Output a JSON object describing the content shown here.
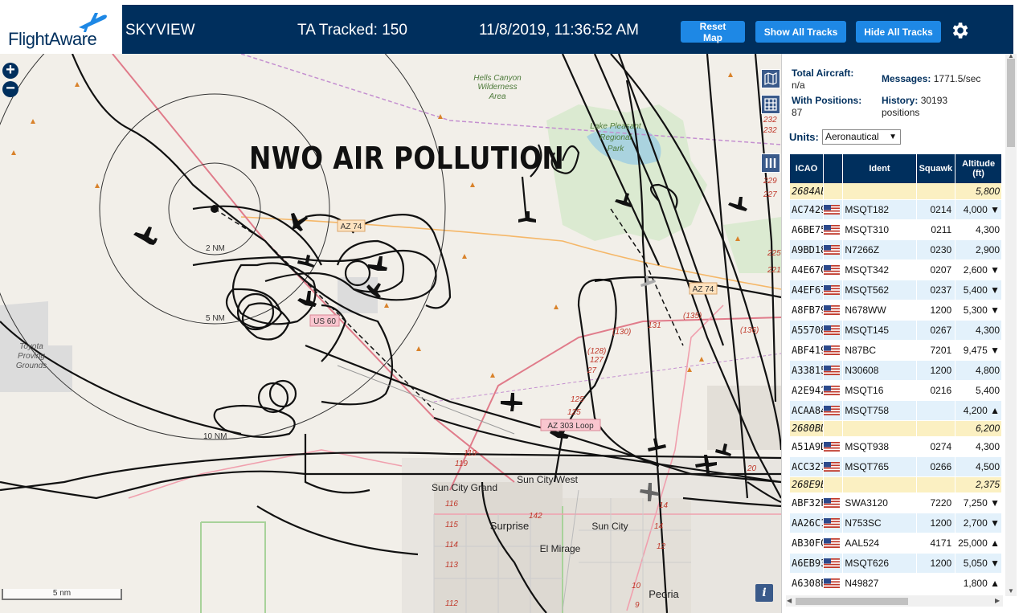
{
  "header": {
    "logo_text": "FlightAware",
    "app_name": "SKYVIEW",
    "tracked_label": "TA Tracked: 150",
    "datetime": "11/8/2019, 11:36:52 AM",
    "buttons": {
      "reset_map": "Reset Map",
      "show_all_tracks": "Show All Tracks",
      "hide_all_tracks": "Hide All Tracks"
    },
    "brand_color": "#002f5d",
    "button_color": "#1e88e5"
  },
  "map": {
    "overlay_caption": "NWO AIR POLLUTION",
    "zoom_in": "+",
    "zoom_out": "−",
    "scale": "5 nm",
    "info": "i",
    "labels": {
      "hells_canyon": [
        "Hells Canyon",
        "Wilderness",
        "Area"
      ],
      "lake_pleasant": [
        "Lake Pleasant",
        "Regional",
        "Park"
      ],
      "toyota": [
        "Toyota",
        "Proving",
        "Grounds"
      ],
      "sun_city_grand": "Sun City Grand",
      "sun_city_west": "Sun City West",
      "surprise": "Surprise",
      "sun_city": "Sun City",
      "el_mirage": "El Mirage",
      "peoria": "Peoria",
      "az74_a": "AZ 74",
      "az74_b": "AZ 74",
      "us60": "US 60",
      "az303": "AZ 303 Loop",
      "ring_2": "2 NM",
      "ring_5": "5 NM",
      "ring_10": "10 NM",
      "r130": "(130)",
      "r131": "131",
      "r135": "(135)",
      "r136": "(136)",
      "r128": "(128)",
      "r127": "127",
      "r27": "27",
      "r125a": "125",
      "r125b": "125",
      "r119a": "119",
      "r119b": "119",
      "r116": "116",
      "r115": "115",
      "r114": "114",
      "r113": "113",
      "r112": "112",
      "r142": "142",
      "r14a": "14",
      "r14b": "14",
      "r12": "12",
      "r10": "10",
      "r9": "9",
      "r20": "20",
      "r232a": "232",
      "r232b": "232",
      "r229": "229",
      "r227": "227",
      "r225": "225",
      "r221": "221"
    }
  },
  "sidebar": {
    "total_aircraft_label": "Total Aircraft:",
    "total_aircraft_value": "n/a",
    "with_positions_label": "With Positions:",
    "with_positions_value": "87",
    "messages_label": "Messages:",
    "messages_value": "1771.5/sec",
    "history_label": "History:",
    "history_value": "30193",
    "history_unit": "positions",
    "units_label": "Units:",
    "units_value": "Aeronautical",
    "columns": [
      "ICAO",
      "",
      "Ident",
      "Squawk",
      "Altitude (ft)"
    ],
    "rows": [
      {
        "icao": "2684AE",
        "flag": false,
        "ident": "",
        "squawk": "",
        "alt": "5,800",
        "hl": true
      },
      {
        "icao": "AC7429",
        "flag": true,
        "ident": "MSQT182",
        "squawk": "0214",
        "alt": "4,000 ▼"
      },
      {
        "icao": "A6BE75",
        "flag": true,
        "ident": "MSQT310",
        "squawk": "0211",
        "alt": "4,300"
      },
      {
        "icao": "A9BD18",
        "flag": true,
        "ident": "N7266Z",
        "squawk": "0230",
        "alt": "2,900"
      },
      {
        "icao": "A4E670",
        "flag": true,
        "ident": "MSQT342",
        "squawk": "0207",
        "alt": "2,600 ▼"
      },
      {
        "icao": "A4EF67",
        "flag": true,
        "ident": "MSQT562",
        "squawk": "0237",
        "alt": "5,400 ▼"
      },
      {
        "icao": "A8FB79",
        "flag": true,
        "ident": "N678WW",
        "squawk": "1200",
        "alt": "5,300 ▼"
      },
      {
        "icao": "A55708",
        "flag": true,
        "ident": "MSQT145",
        "squawk": "0267",
        "alt": "4,300"
      },
      {
        "icao": "ABF419",
        "flag": true,
        "ident": "N87BC",
        "squawk": "7201",
        "alt": "9,475 ▼"
      },
      {
        "icao": "A33815",
        "flag": true,
        "ident": "N30608",
        "squawk": "1200",
        "alt": "4,800"
      },
      {
        "icao": "A2E942",
        "flag": true,
        "ident": "MSQT16",
        "squawk": "0216",
        "alt": "5,400"
      },
      {
        "icao": "ACAA84",
        "flag": true,
        "ident": "MSQT758",
        "squawk": "",
        "alt": "4,200 ▲"
      },
      {
        "icao": "2680BD",
        "flag": false,
        "ident": "",
        "squawk": "",
        "alt": "6,200",
        "hl": true
      },
      {
        "icao": "A51A9D",
        "flag": true,
        "ident": "MSQT938",
        "squawk": "0274",
        "alt": "4,300"
      },
      {
        "icao": "ACC327",
        "flag": true,
        "ident": "MSQT765",
        "squawk": "0266",
        "alt": "4,500"
      },
      {
        "icao": "268E9B",
        "flag": false,
        "ident": "",
        "squawk": "",
        "alt": "2,375",
        "hl": true
      },
      {
        "icao": "ABF32F",
        "flag": true,
        "ident": "SWA3120",
        "squawk": "7220",
        "alt": "7,250 ▼"
      },
      {
        "icao": "AA26C1",
        "flag": true,
        "ident": "N753SC",
        "squawk": "1200",
        "alt": "2,700 ▼"
      },
      {
        "icao": "AB30F0",
        "flag": true,
        "ident": "AAL524",
        "squawk": "4171",
        "alt": "25,000 ▲"
      },
      {
        "icao": "A6EB93",
        "flag": true,
        "ident": "MSQT626",
        "squawk": "1200",
        "alt": "5,050 ▼"
      },
      {
        "icao": "A6308E",
        "flag": true,
        "ident": "N49827",
        "squawk": "",
        "alt": "1,800 ▲"
      }
    ]
  }
}
